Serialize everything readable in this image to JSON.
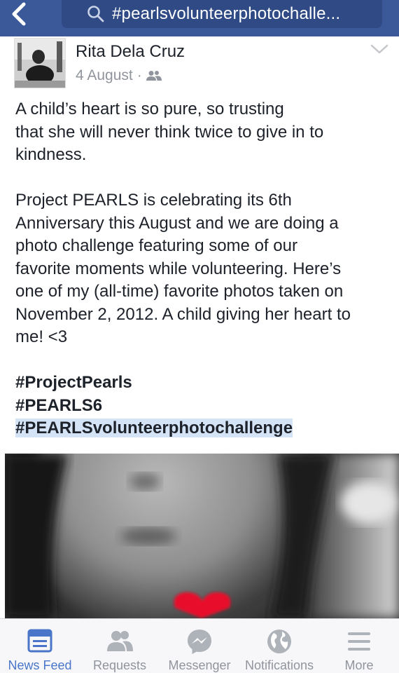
{
  "search": {
    "query": "#pearlsvolunteerphotochalle..."
  },
  "post": {
    "author": "Rita Dela Cruz",
    "date": "4 August",
    "privacy_icon": "friends-icon",
    "paragraphs": [
      "A child’s heart is so pure, so trusting\nthat she will never think twice to give in to\nkindness.",
      "Project PEARLS is celebrating its 6th\nAnniversary this August and we are doing a\nphoto challenge featuring some of our\nfavorite moments while volunteering. Here’s\none of my (all-time) favorite photos taken on\nNovember 2, 2012. A child giving her heart to\nme! <3"
    ],
    "hashtags": [
      "#ProjectPearls",
      "#PEARLS6",
      "#PEARLSvolunteerphotochallenge"
    ]
  },
  "nav": {
    "items": [
      {
        "label": "News Feed",
        "icon": "news-feed-icon",
        "active": true
      },
      {
        "label": "Requests",
        "icon": "friend-requests-icon",
        "active": false
      },
      {
        "label": "Messenger",
        "icon": "messenger-icon",
        "active": false
      },
      {
        "label": "Notifications",
        "icon": "globe-icon",
        "active": false
      },
      {
        "label": "More",
        "icon": "menu-icon",
        "active": false
      }
    ]
  },
  "colors": {
    "topbar": "#3b5998",
    "active_nav": "#4a76c9",
    "inactive_nav": "#90949c",
    "heart": "#e8102a",
    "hashtag_highlight": "#d5e3f7"
  }
}
